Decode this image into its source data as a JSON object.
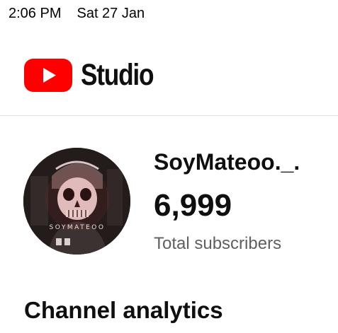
{
  "status_bar": {
    "time": "2:06 PM",
    "date": "Sat 27 Jan"
  },
  "header": {
    "app_name": "Studio",
    "logo_icon": "youtube-play-icon",
    "brand_color": "#ff0000"
  },
  "channel": {
    "name": "SoyMateoo._.",
    "subscriber_count": "6,999",
    "subscriber_label": "Total subscribers",
    "avatar_text": "SOYMATEOO"
  },
  "sections": {
    "analytics_title": "Channel analytics"
  }
}
